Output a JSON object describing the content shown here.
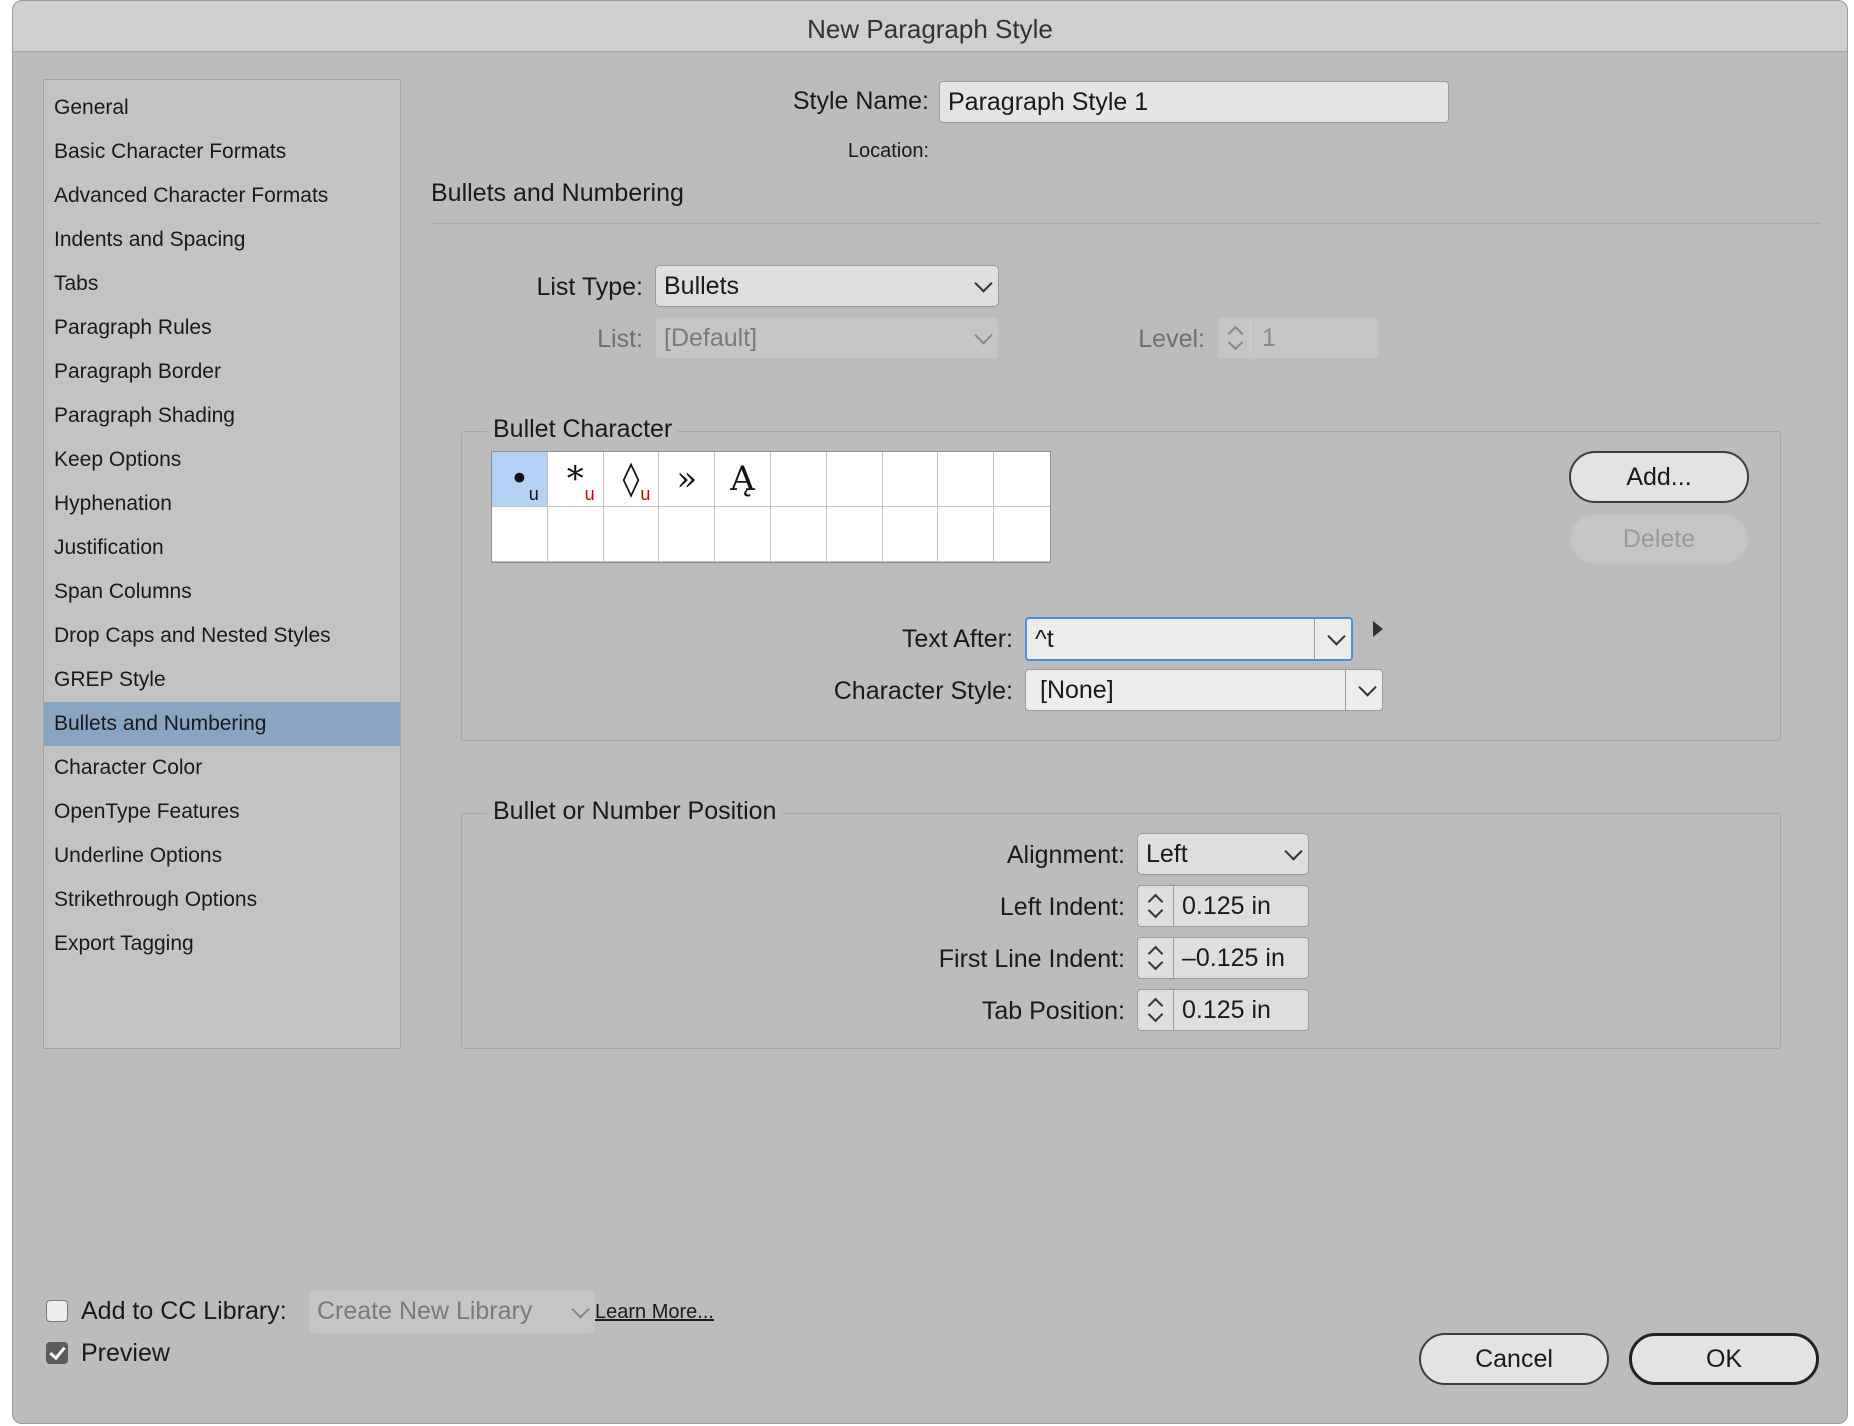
{
  "window": {
    "title": "New Paragraph Style"
  },
  "sidebar": {
    "items": [
      {
        "label": "General"
      },
      {
        "label": "Basic Character Formats"
      },
      {
        "label": "Advanced Character Formats"
      },
      {
        "label": "Indents and Spacing"
      },
      {
        "label": "Tabs"
      },
      {
        "label": "Paragraph Rules"
      },
      {
        "label": "Paragraph Border"
      },
      {
        "label": "Paragraph Shading"
      },
      {
        "label": "Keep Options"
      },
      {
        "label": "Hyphenation"
      },
      {
        "label": "Justification"
      },
      {
        "label": "Span Columns"
      },
      {
        "label": "Drop Caps and Nested Styles"
      },
      {
        "label": "GREP Style"
      },
      {
        "label": "Bullets and Numbering",
        "selected": true
      },
      {
        "label": "Character Color"
      },
      {
        "label": "OpenType Features"
      },
      {
        "label": "Underline Options"
      },
      {
        "label": "Strikethrough Options"
      },
      {
        "label": "Export Tagging"
      }
    ]
  },
  "header": {
    "style_name_label": "Style Name:",
    "style_name_value": "Paragraph Style 1",
    "location_label": "Location:",
    "section_title": "Bullets and Numbering"
  },
  "list": {
    "list_type_label": "List Type:",
    "list_type_value": "Bullets",
    "list_label": "List:",
    "list_value": "[Default]",
    "level_label": "Level:",
    "level_value": "1"
  },
  "bullet_character": {
    "group_title": "Bullet Character",
    "glyphs": [
      {
        "char": "•",
        "mark": "u"
      },
      {
        "char": "*",
        "mark": "u"
      },
      {
        "char": "◊",
        "mark": "u"
      },
      {
        "char": "»",
        "mark": ""
      },
      {
        "char": "Ą",
        "mark": ""
      }
    ],
    "add_button": "Add...",
    "delete_button": "Delete",
    "text_after_label": "Text After:",
    "text_after_value": "^t",
    "character_style_label": "Character Style:",
    "character_style_value": "[None]"
  },
  "position": {
    "group_title": "Bullet or Number Position",
    "alignment_label": "Alignment:",
    "alignment_value": "Left",
    "left_indent_label": "Left Indent:",
    "left_indent_value": "0.125 in",
    "first_line_indent_label": "First Line Indent:",
    "first_line_indent_value": "–0.125 in",
    "tab_position_label": "Tab Position:",
    "tab_position_value": "0.125 in"
  },
  "footer": {
    "cc_library_label": "Add to CC Library:",
    "cc_library_checked": false,
    "cc_library_value": "Create New Library",
    "learn_more": "Learn More...",
    "preview_label": "Preview",
    "preview_checked": true,
    "cancel_button": "Cancel",
    "ok_button": "OK"
  },
  "colors": {
    "dialog_bg": "#bcbcbc",
    "selected_item": "#8aa4c4",
    "selected_glyph": "#b3d2f6",
    "mark_red": "#d10000"
  }
}
